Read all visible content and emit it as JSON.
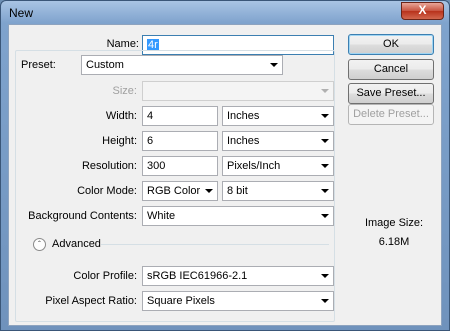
{
  "window": {
    "title": "New",
    "close_label": "X"
  },
  "name": {
    "label": "Name:",
    "value": "4r"
  },
  "preset": {
    "label": "Preset:",
    "value": "Custom"
  },
  "size": {
    "label": "Size:",
    "value": ""
  },
  "width": {
    "label": "Width:",
    "value": "4",
    "unit": "Inches"
  },
  "height": {
    "label": "Height:",
    "value": "6",
    "unit": "Inches"
  },
  "resolution": {
    "label": "Resolution:",
    "value": "300",
    "unit": "Pixels/Inch"
  },
  "color_mode": {
    "label": "Color Mode:",
    "value": "RGB Color",
    "depth": "8 bit"
  },
  "background": {
    "label": "Background Contents:",
    "value": "White"
  },
  "advanced": {
    "label": "Advanced"
  },
  "color_profile": {
    "label": "Color Profile:",
    "value": "sRGB IEC61966-2.1"
  },
  "pixel_aspect": {
    "label": "Pixel Aspect Ratio:",
    "value": "Square Pixels"
  },
  "buttons": {
    "ok": "OK",
    "cancel": "Cancel",
    "save_preset": "Save Preset...",
    "delete_preset": "Delete Preset..."
  },
  "image_size": {
    "label": "Image Size:",
    "value": "6.18M"
  },
  "icons": {
    "advanced_toggle": "chevron-up-circle-icon",
    "dropdown": "triangle-down-icon"
  }
}
